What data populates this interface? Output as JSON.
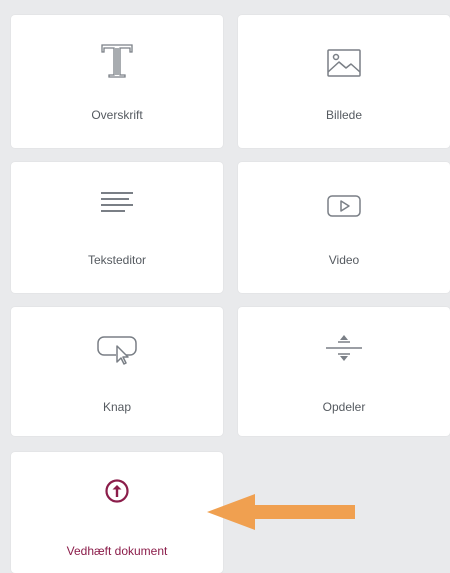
{
  "widgets": [
    {
      "label": "Overskrift",
      "icon": "heading-icon"
    },
    {
      "label": "Billede",
      "icon": "image-icon"
    },
    {
      "label": "Teksteditor",
      "icon": "text-editor-icon"
    },
    {
      "label": "Video",
      "icon": "video-icon"
    },
    {
      "label": "Knap",
      "icon": "button-icon"
    },
    {
      "label": "Opdeler",
      "icon": "divider-icon"
    },
    {
      "label": "Vedhæft dokument",
      "icon": "attach-document-icon"
    }
  ],
  "colors": {
    "background": "#e9eaec",
    "tile": "#ffffff",
    "icon_gray": "#7a7f86",
    "highlight": "#8b1d4a",
    "arrow": "#f0a050"
  }
}
